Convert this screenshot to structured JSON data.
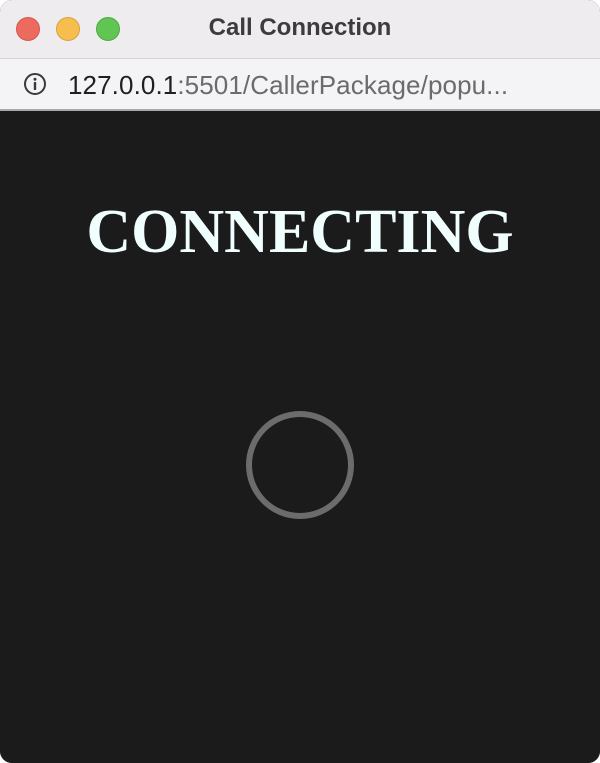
{
  "window": {
    "title": "Call Connection"
  },
  "urlbar": {
    "host": "127.0.0.1",
    "path": ":5501/CallerPackage/popu..."
  },
  "page": {
    "heading": "CONNECTING"
  },
  "icons": {
    "info": "info-circle-icon",
    "spinner": "loading-spinner-icon"
  },
  "colors": {
    "background": "#1b1b1b",
    "heading": "#f0fffe",
    "spinner": "#6c6c6c",
    "close": "#ed6a5e",
    "minimize": "#f5be4f",
    "zoom": "#61c554"
  }
}
